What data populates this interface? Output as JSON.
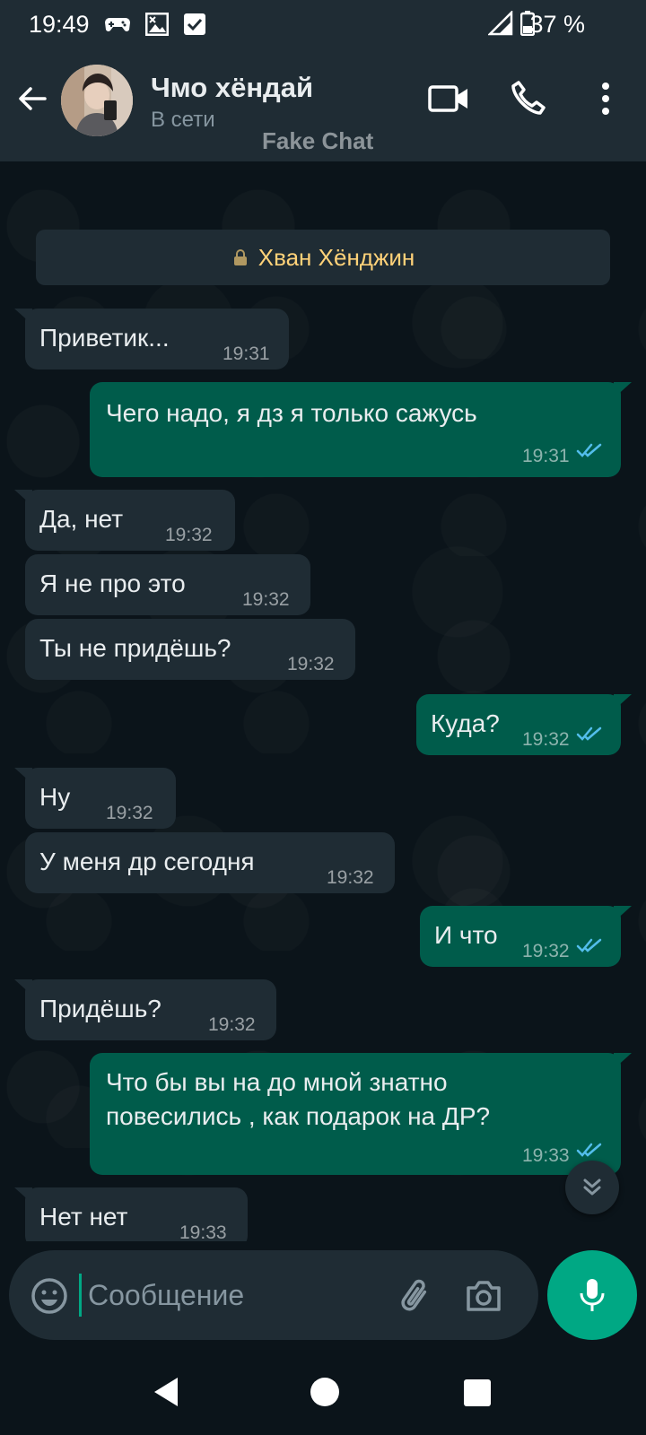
{
  "status_bar": {
    "time": "19:49",
    "battery": "37 %"
  },
  "header": {
    "contact_name": "Чмо хёндай",
    "status": "В сети",
    "watermark": "Fake Chat"
  },
  "banner": {
    "text": "Хван Хёнджин"
  },
  "messages": [
    {
      "dir": "in",
      "text": "Приветик...",
      "time": "19:31"
    },
    {
      "dir": "out",
      "text": "Чего надо, я дз я только сажусь",
      "time": "19:31",
      "read": true
    },
    {
      "dir": "in",
      "text": "Да, нет",
      "time": "19:32"
    },
    {
      "dir": "in",
      "text": "Я не про это",
      "time": "19:32"
    },
    {
      "dir": "in",
      "text": "Ты не придёшь?",
      "time": "19:32"
    },
    {
      "dir": "out",
      "text": "Куда?",
      "time": "19:32",
      "read": true
    },
    {
      "dir": "in",
      "text": "Ну",
      "time": "19:32"
    },
    {
      "dir": "in",
      "text": "У меня др сегодня",
      "time": "19:32"
    },
    {
      "dir": "out",
      "text": "И что",
      "time": "19:32",
      "read": true
    },
    {
      "dir": "in",
      "text": "Придёшь?",
      "time": "19:32"
    },
    {
      "dir": "out",
      "text_line1": "Что бы вы на до мной знатно",
      "text_line2": "повесились , как подарок на ДР?",
      "time": "19:33",
      "read": true
    },
    {
      "dir": "in",
      "text": "Нет нет",
      "time": "19:33"
    }
  ],
  "composer": {
    "placeholder": "Сообщение"
  },
  "colors": {
    "incoming": "#1f2c34",
    "outgoing": "#005c4b",
    "accent": "#00a884",
    "read_ticks": "#53bdeb",
    "banner_text": "#ffd279"
  }
}
